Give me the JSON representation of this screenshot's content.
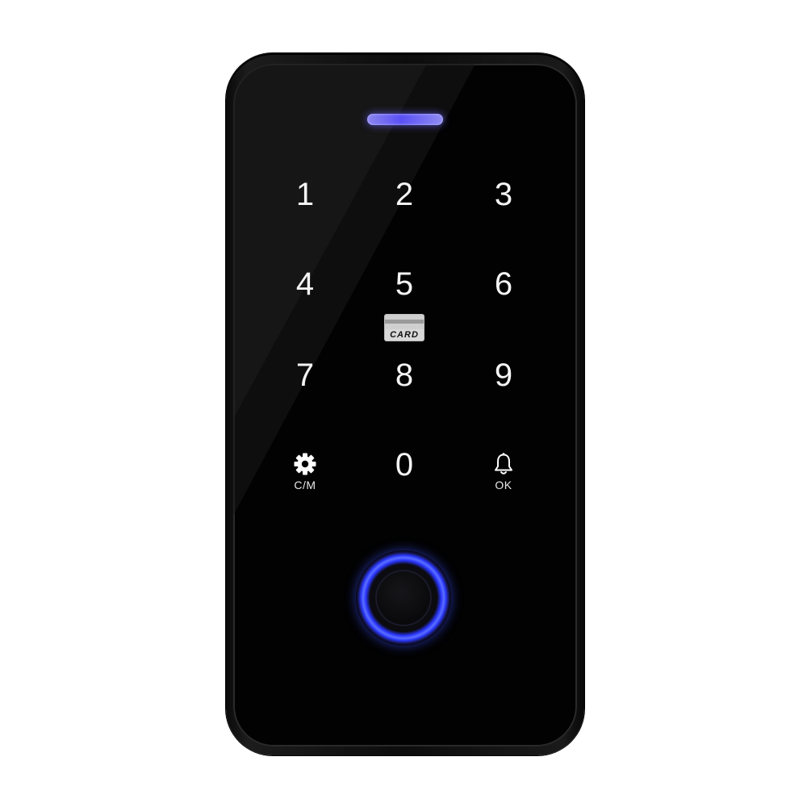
{
  "device": {
    "card_label": "CARD",
    "keys": [
      {
        "id": "1",
        "label": "1"
      },
      {
        "id": "2",
        "label": "2"
      },
      {
        "id": "3",
        "label": "3"
      },
      {
        "id": "4",
        "label": "4"
      },
      {
        "id": "5",
        "label": "5"
      },
      {
        "id": "6",
        "label": "6"
      },
      {
        "id": "7",
        "label": "7"
      },
      {
        "id": "8",
        "label": "8"
      },
      {
        "id": "9",
        "label": "9"
      },
      {
        "id": "0",
        "label": "0"
      }
    ],
    "settings_key": {
      "icon": "gear-icon",
      "label": "C/M"
    },
    "ok_key": {
      "icon": "bell-icon",
      "label": "OK"
    },
    "colors": {
      "status_led": "#6a60f5",
      "fingerprint_ring": "#3a4cff",
      "face": "#020202",
      "key_text": "#f4f4f4"
    }
  }
}
